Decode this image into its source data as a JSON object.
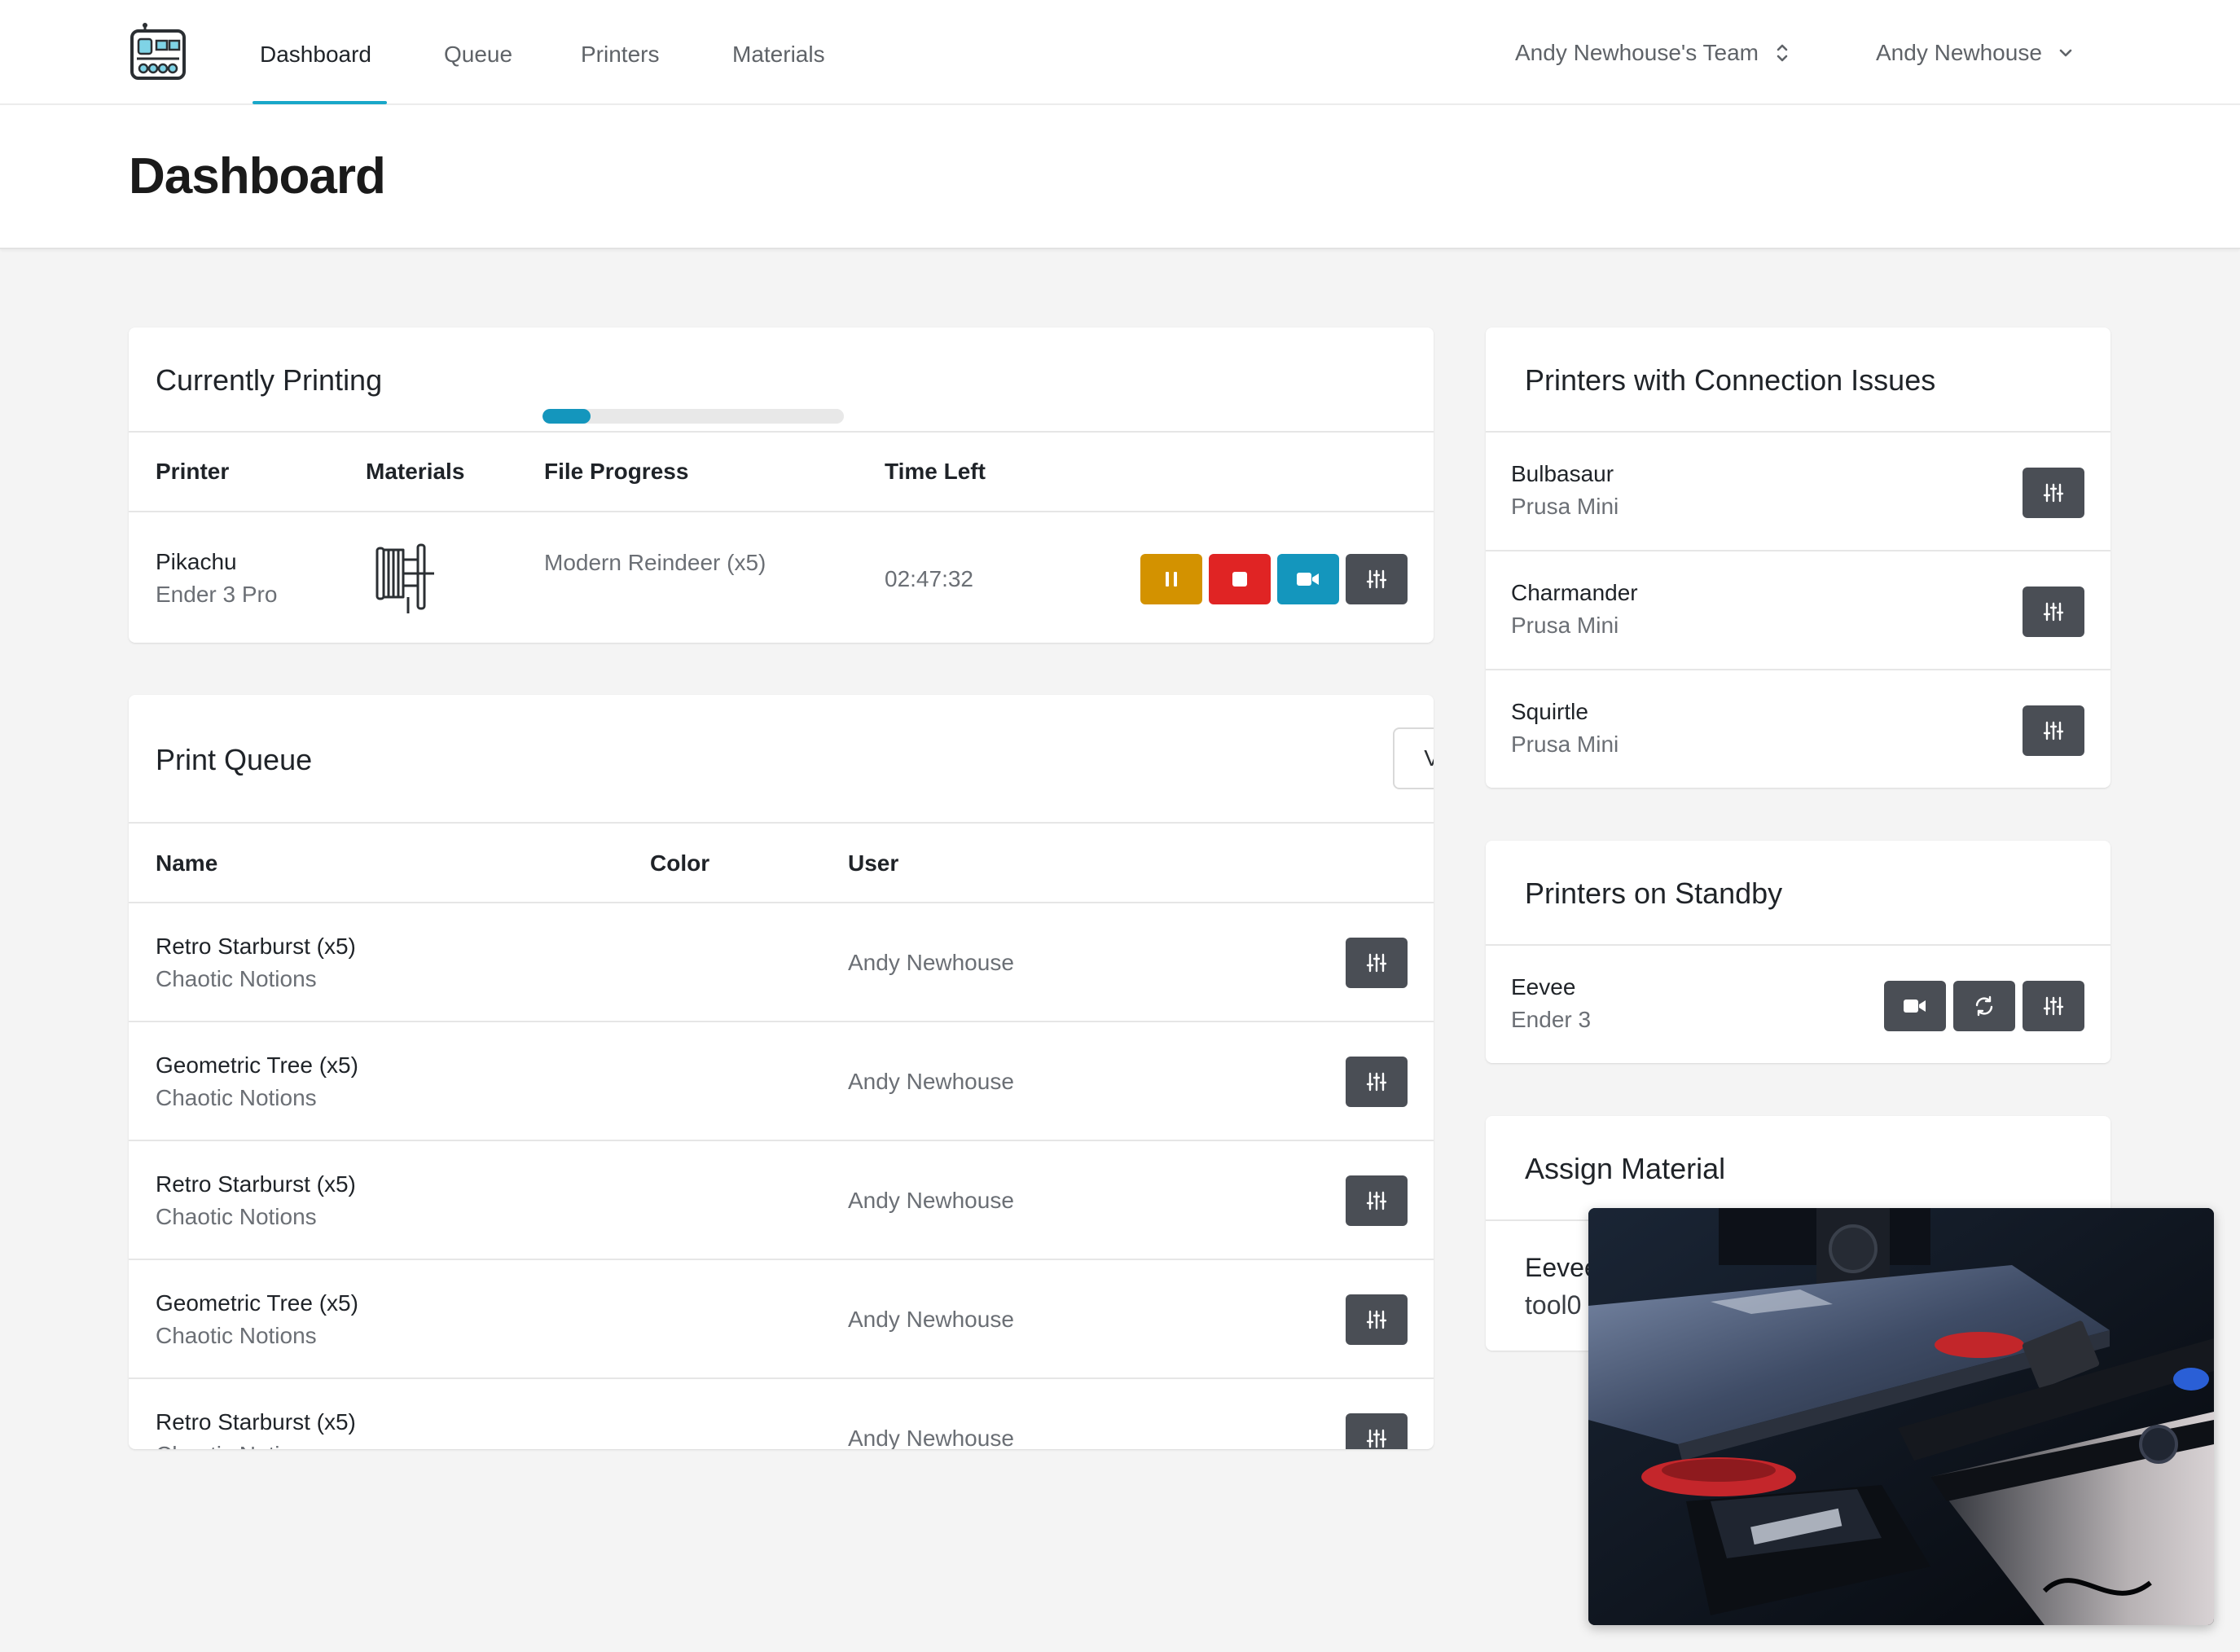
{
  "nav": {
    "items": [
      {
        "label": "Dashboard",
        "active": true
      },
      {
        "label": "Queue",
        "active": false
      },
      {
        "label": "Printers",
        "active": false
      },
      {
        "label": "Materials",
        "active": false
      }
    ],
    "team": "Andy Newhouse's Team",
    "user": "Andy Newhouse"
  },
  "page": {
    "title": "Dashboard"
  },
  "currently_printing": {
    "title": "Currently Printing",
    "columns": [
      "Printer",
      "Materials",
      "File Progress",
      "Time Left"
    ],
    "rows": [
      {
        "printer": "Pikachu",
        "model": "Ender 3 Pro",
        "material_icon": "filament-spool-icon",
        "file": "Modern Reindeer (x5)",
        "progress": 0.16,
        "time_left": "02:47:32",
        "actions": [
          "pause-icon",
          "stop-icon",
          "video-camera-icon",
          "adjustments-icon"
        ]
      }
    ]
  },
  "print_queue": {
    "title": "Print Queue",
    "view_all": "View All",
    "columns": [
      "Name",
      "Color",
      "User"
    ],
    "rows": [
      {
        "name": "Retro Starburst (x5)",
        "sub": "Chaotic Notions",
        "user": "Andy Newhouse"
      },
      {
        "name": "Geometric Tree (x5)",
        "sub": "Chaotic Notions",
        "user": "Andy Newhouse"
      },
      {
        "name": "Retro Starburst (x5)",
        "sub": "Chaotic Notions",
        "user": "Andy Newhouse"
      },
      {
        "name": "Geometric Tree (x5)",
        "sub": "Chaotic Notions",
        "user": "Andy Newhouse"
      },
      {
        "name": "Retro Starburst (x5)",
        "sub": "Chaotic Notions",
        "user": "Andy Newhouse"
      }
    ]
  },
  "connection_issues": {
    "title": "Printers with Connection Issues",
    "rows": [
      {
        "name": "Bulbasaur",
        "model": "Prusa Mini"
      },
      {
        "name": "Charmander",
        "model": "Prusa Mini"
      },
      {
        "name": "Squirtle",
        "model": "Prusa Mini"
      }
    ]
  },
  "standby": {
    "title": "Printers on Standby",
    "rows": [
      {
        "name": "Eevee",
        "model": "Ender 3",
        "actions": [
          "video-camera-icon",
          "refresh-icon",
          "adjustments-icon"
        ]
      }
    ]
  },
  "assign_material": {
    "title": "Assign Material",
    "rows": [
      {
        "name": "Eevee",
        "tool": "tool0"
      }
    ]
  },
  "colors": {
    "accent": "#19a7c9",
    "pause": "#d39200",
    "stop": "#e02424",
    "camera": "#1496bd",
    "dark_button": "#4a4e55"
  }
}
